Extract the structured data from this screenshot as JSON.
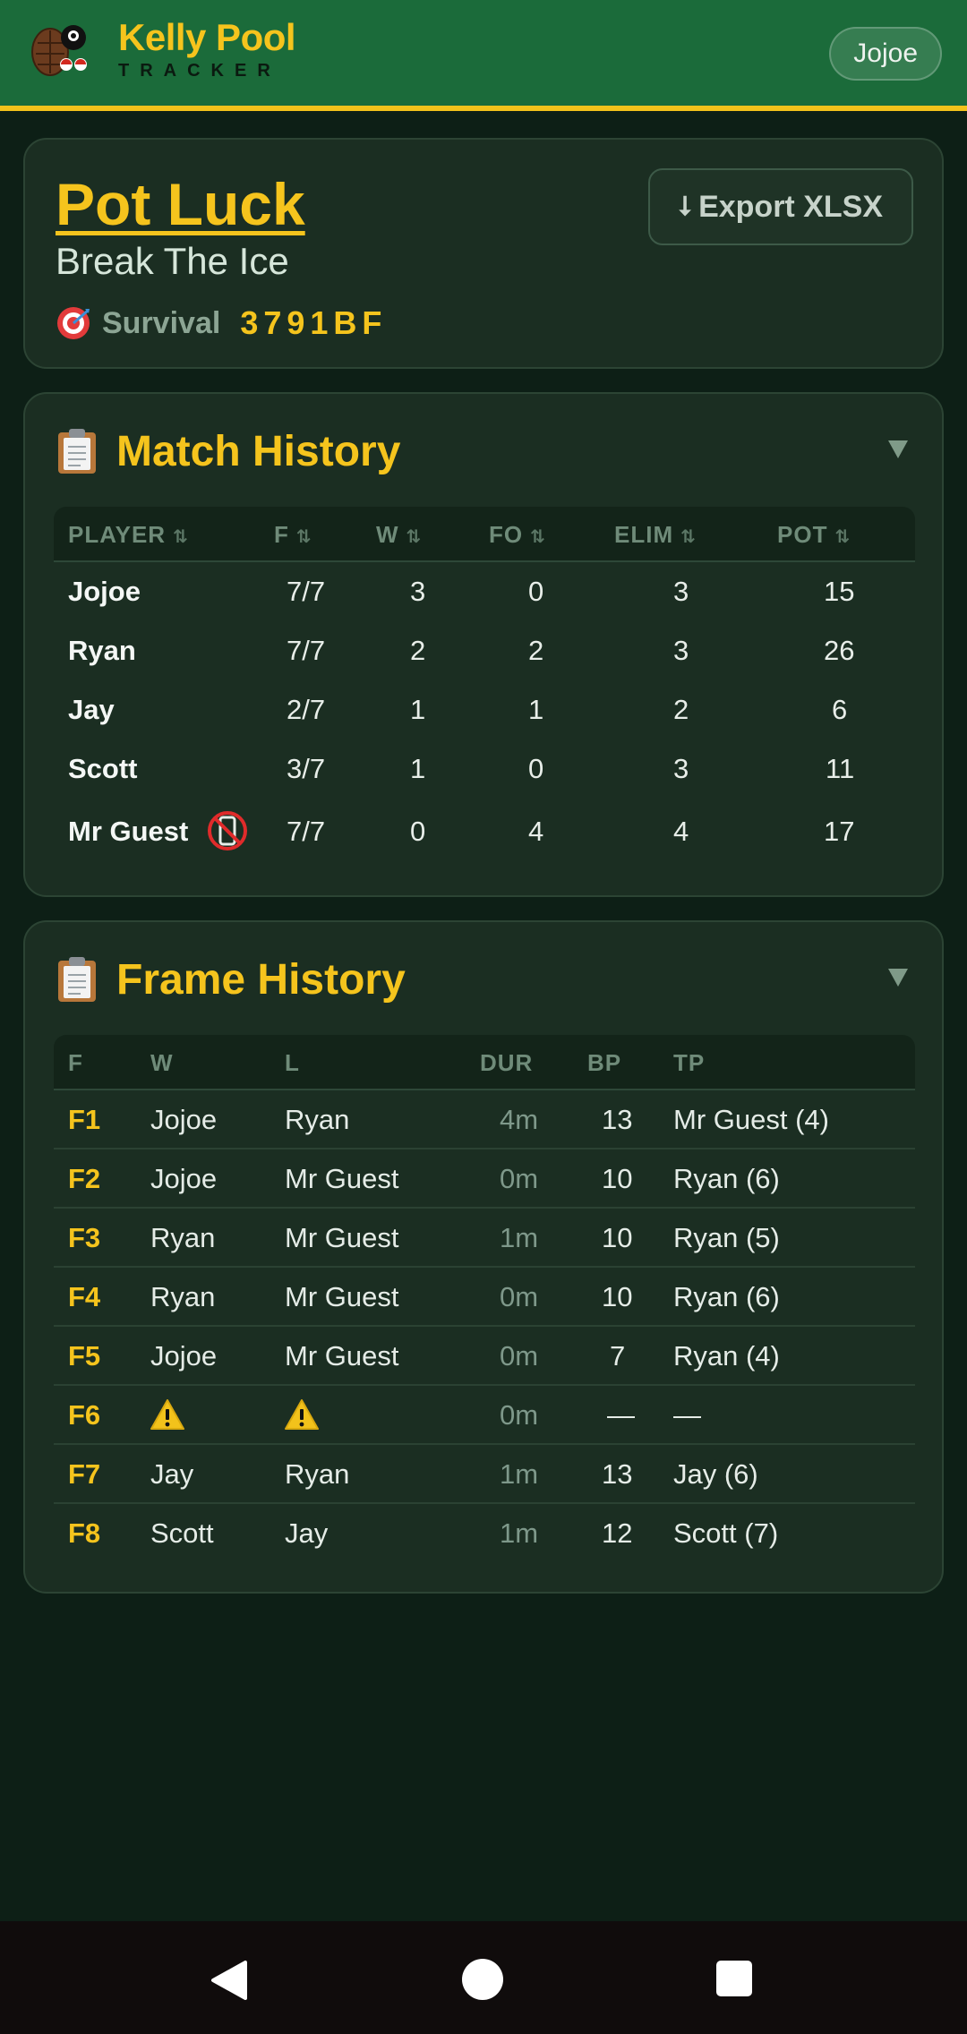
{
  "app": {
    "brand_title": "Kelly Pool",
    "brand_subtitle": "TRACKER",
    "user_name": "Jojoe"
  },
  "match": {
    "title": "Pot Luck",
    "subtitle": "Break The Ice",
    "mode_icon": "target-icon",
    "mode": "Survival",
    "code": "3791BF",
    "export_label": "Export XLSX"
  },
  "match_history": {
    "title": "Match History",
    "icon": "clipboard-icon",
    "columns": [
      "PLAYER",
      "F",
      "W",
      "FO",
      "ELIM",
      "POT"
    ],
    "rows": [
      {
        "player": "Jojoe",
        "f": "7/7",
        "w": "3",
        "fo": "0",
        "elim": "3",
        "pot": "15"
      },
      {
        "player": "Ryan",
        "f": "7/7",
        "w": "2",
        "fo": "2",
        "elim": "3",
        "pot": "26"
      },
      {
        "player": "Jay",
        "f": "2/7",
        "w": "1",
        "fo": "1",
        "elim": "2",
        "pot": "6"
      },
      {
        "player": "Scott",
        "f": "3/7",
        "w": "1",
        "fo": "0",
        "elim": "3",
        "pot": "11"
      },
      {
        "player": "Mr Guest",
        "f": "7/7",
        "w": "0",
        "fo": "4",
        "elim": "4",
        "pot": "17",
        "badge_icon": "no-phone-icon"
      }
    ]
  },
  "frame_history": {
    "title": "Frame History",
    "icon": "clipboard-icon",
    "columns": [
      "F",
      "W",
      "L",
      "DUR",
      "BP",
      "TP"
    ],
    "rows": [
      {
        "f": "F1",
        "w": "Jojoe",
        "l": "Ryan",
        "dur": "4m",
        "bp": "13",
        "tp": "Mr Guest (4)"
      },
      {
        "f": "F2",
        "w": "Jojoe",
        "l": "Mr Guest",
        "dur": "0m",
        "bp": "10",
        "tp": "Ryan (6)"
      },
      {
        "f": "F3",
        "w": "Ryan",
        "l": "Mr Guest",
        "dur": "1m",
        "bp": "10",
        "tp": "Ryan (5)"
      },
      {
        "f": "F4",
        "w": "Ryan",
        "l": "Mr Guest",
        "dur": "0m",
        "bp": "10",
        "tp": "Ryan (6)"
      },
      {
        "f": "F5",
        "w": "Jojoe",
        "l": "Mr Guest",
        "dur": "0m",
        "bp": "7",
        "tp": "Ryan (4)"
      },
      {
        "f": "F6",
        "w": "",
        "l": "",
        "dur": "0m",
        "bp": "—",
        "tp": "—",
        "warning_icon": "warning-icon"
      },
      {
        "f": "F7",
        "w": "Jay",
        "l": "Ryan",
        "dur": "1m",
        "bp": "13",
        "tp": "Jay (6)"
      },
      {
        "f": "F8",
        "w": "Scott",
        "l": "Jay",
        "dur": "1m",
        "bp": "12",
        "tp": "Scott (7)"
      }
    ]
  },
  "colors": {
    "accent": "#f5c41d",
    "header_green": "#1b6b3a",
    "background": "#0d1f16",
    "card": "#1b2e22"
  }
}
